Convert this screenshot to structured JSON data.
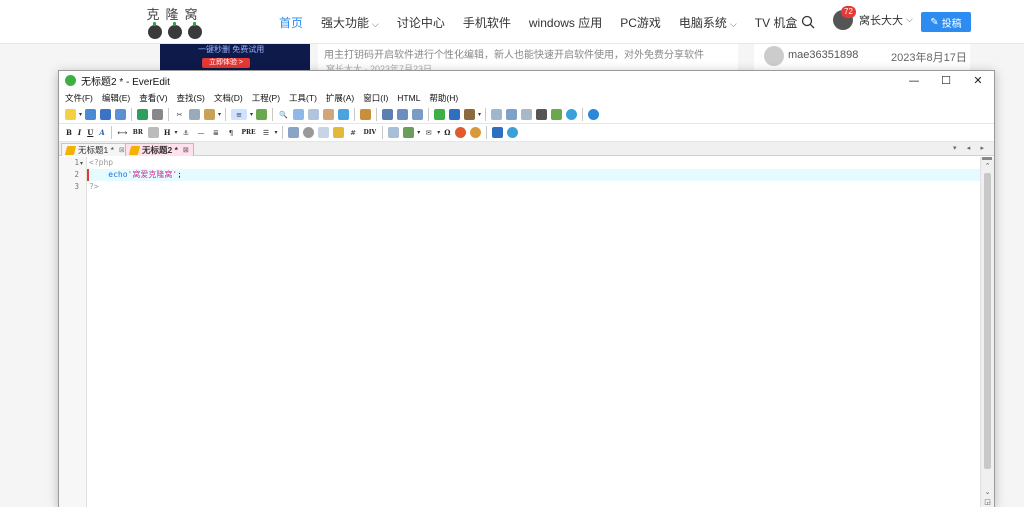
{
  "site": {
    "logo_text": "克隆窝",
    "nav": [
      {
        "label": "首页",
        "active": true,
        "dropdown": false
      },
      {
        "label": "强大功能",
        "active": false,
        "dropdown": true
      },
      {
        "label": "讨论中心",
        "active": false,
        "dropdown": false
      },
      {
        "label": "手机软件",
        "active": false,
        "dropdown": false
      },
      {
        "label": "windows 应用",
        "active": false,
        "dropdown": false
      },
      {
        "label": "PC游戏",
        "active": false,
        "dropdown": false
      },
      {
        "label": "电脑系统",
        "active": false,
        "dropdown": true
      },
      {
        "label": "TV 机盒",
        "active": false,
        "dropdown": false
      }
    ],
    "search_icon": "search-icon",
    "user": {
      "badge": "72",
      "name": "窝长大大",
      "caret": "⌵"
    },
    "post_button": "投稿",
    "banner": {
      "text": "一键秒删 免费试用",
      "button": "立即体验 >"
    },
    "mid_text": "用主打钥码开启软件进行个性化编辑，新人也能快速开启软件使用，对外免费分享软件",
    "mid_meta": "窝长大大 · 2023年7月23日",
    "side": {
      "name": "mae36351898",
      "date": "2023年8月17日"
    }
  },
  "window": {
    "title": "无标题2 * - EverEdit",
    "controls": {
      "minimize": "—",
      "maximize": "☐",
      "close": "✕"
    },
    "menu": [
      "文件(F)",
      "编辑(E)",
      "查看(V)",
      "查找(S)",
      "文档(D)",
      "工程(P)",
      "工具(T)",
      "扩展(A)",
      "窗口(I)",
      "HTML",
      "帮助(H)"
    ],
    "toolbar2_text": [
      "B",
      "I",
      "U",
      "A",
      "BR",
      "H",
      "PRE",
      "DIV",
      "Ω"
    ],
    "tabs": [
      {
        "label": "无标题1 *",
        "close": "⊠",
        "active": false
      },
      {
        "label": "无标题2 *",
        "close": "⊠",
        "active": true
      }
    ],
    "tab_nav": "▾ ◂ ▸"
  },
  "editor": {
    "lines": [
      {
        "num": "1",
        "text": "<?php"
      },
      {
        "num": "2",
        "indent": "    ",
        "keyword": "echo",
        "string": "'窝爱克隆窝'",
        "end": ";"
      },
      {
        "num": "3",
        "text": "?>"
      }
    ]
  }
}
